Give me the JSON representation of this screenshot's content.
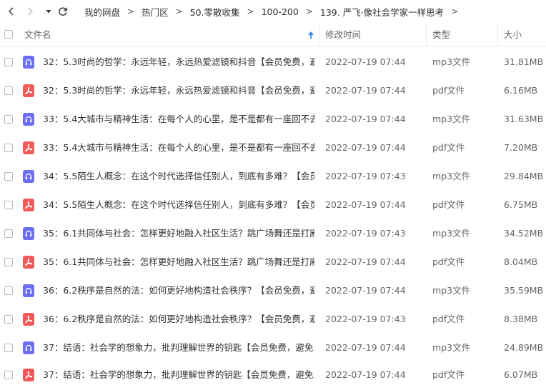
{
  "breadcrumb": [
    "我的网盘",
    "热门区",
    "50.零散收集",
    "100-200",
    "139. 严飞·像社会学家一样思考"
  ],
  "breadcrumb_separator": ">",
  "columns": {
    "name": "文件名",
    "modified": "修改时间",
    "type": "类型",
    "size": "大小"
  },
  "sort": {
    "column": "name",
    "direction": "ascending"
  },
  "colors": {
    "mp3_icon": "#6c6ff1",
    "pdf_icon": "#f25a5a",
    "sort_arrow": "#3d8bf2"
  },
  "files": [
    {
      "name": "32：5.3时尚的哲学：永远年轻，永远热爱滤镜和抖音【会员免费，避...",
      "modified": "2022-07-19 07:44",
      "type": "mp3文件",
      "size": "31.81MB",
      "icon": "headphones-icon"
    },
    {
      "name": "32：5.3时尚的哲学：永远年轻，永远热爱滤镜和抖音【会员免费，避...",
      "modified": "2022-07-19 07:44",
      "type": "pdf文件",
      "size": "6.16MB",
      "icon": "pdf-icon"
    },
    {
      "name": "33：5.4大城市与精神生活：在每个人的心里，是不是都有一座回不去...",
      "modified": "2022-07-19 07:44",
      "type": "mp3文件",
      "size": "31.63MB",
      "icon": "headphones-icon"
    },
    {
      "name": "33：5.4大城市与精神生活：在每个人的心里，是不是都有一座回不去...",
      "modified": "2022-07-19 07:44",
      "type": "pdf文件",
      "size": "7.20MB",
      "icon": "pdf-icon"
    },
    {
      "name": "34：5.5陌生人概念：在这个时代选择信任别人，到底有多难？【会员...",
      "modified": "2022-07-19 07:43",
      "type": "mp3文件",
      "size": "29.84MB",
      "icon": "headphones-icon"
    },
    {
      "name": "34：5.5陌生人概念：在这个时代选择信任别人，到底有多难？【会员...",
      "modified": "2022-07-19 07:44",
      "type": "pdf文件",
      "size": "6.75MB",
      "icon": "pdf-icon"
    },
    {
      "name": "35：6.1共同体与社会：怎样更好地融入社区生活？跳广场舞还是打麻...",
      "modified": "2022-07-19 07:43",
      "type": "mp3文件",
      "size": "34.52MB",
      "icon": "headphones-icon"
    },
    {
      "name": "35：6.1共同体与社会：怎样更好地融入社区生活？跳广场舞还是打麻...",
      "modified": "2022-07-19 07:44",
      "type": "pdf文件",
      "size": "8.04MB",
      "icon": "pdf-icon"
    },
    {
      "name": "36：6.2秩序是自然的法：如何更好地构造社会秩序？【会员免费，避...",
      "modified": "2022-07-19 07:44",
      "type": "mp3文件",
      "size": "35.59MB",
      "icon": "headphones-icon"
    },
    {
      "name": "36：6.2秩序是自然的法：如何更好地构造社会秩序？【会员免费，避...",
      "modified": "2022-07-19 07:43",
      "type": "pdf文件",
      "size": "8.38MB",
      "icon": "pdf-icon"
    },
    {
      "name": "37：结语：社会学的想象力，批判理解世界的钥匙【会员免费，避免...",
      "modified": "2022-07-19 07:44",
      "type": "mp3文件",
      "size": "24.89MB",
      "icon": "headphones-icon"
    },
    {
      "name": "37：结语：社会学的想象力，批判理解世界的钥匙【会员免费，避免...",
      "modified": "2022-07-19 07:44",
      "type": "pdf文件",
      "size": "6.07MB",
      "icon": "pdf-icon"
    }
  ]
}
